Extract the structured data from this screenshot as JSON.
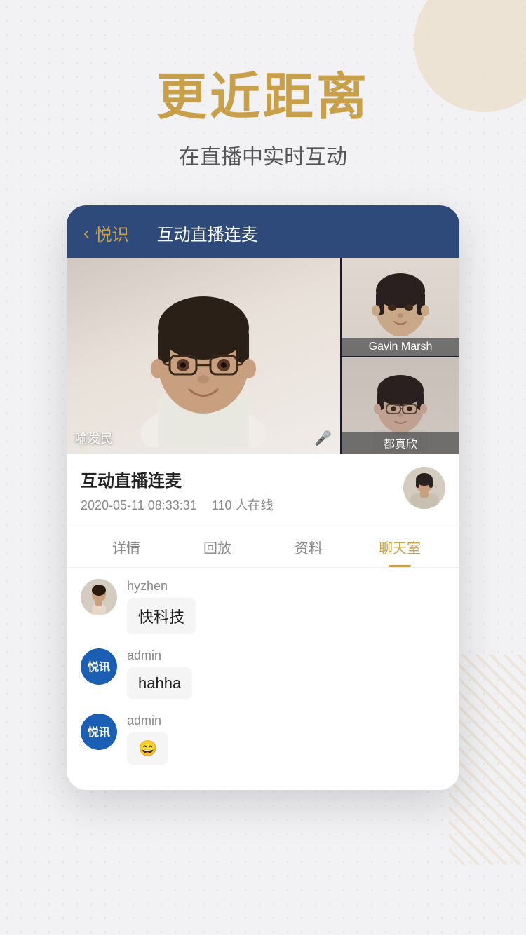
{
  "page": {
    "background_color": "#f2f2f5",
    "main_title": "更近距离",
    "sub_title": "在直播中实时互动"
  },
  "app": {
    "header": {
      "back_label": "悦识",
      "title": "互动直播连麦"
    },
    "video": {
      "main_person_name": "喻发民",
      "side_persons": [
        {
          "name": "Gavin Marsh"
        },
        {
          "name": "都真欣"
        }
      ]
    },
    "session": {
      "name": "互动直播连麦",
      "date": "2020-05-11 08:33:31",
      "viewers": "110 人在线"
    },
    "tabs": [
      {
        "label": "详情",
        "active": false
      },
      {
        "label": "回放",
        "active": false
      },
      {
        "label": "资料",
        "active": false
      },
      {
        "label": "聊天室",
        "active": true
      }
    ],
    "chat": {
      "messages": [
        {
          "username": "hyzhen",
          "avatar_type": "photo",
          "bubble_text": "快科技"
        },
        {
          "username": "admin",
          "avatar_type": "logo",
          "bubble_text": "hahha"
        },
        {
          "username": "admin",
          "avatar_type": "logo",
          "bubble_text": "😄"
        }
      ]
    }
  },
  "icons": {
    "back_chevron": "‹",
    "microphone": "🎤",
    "logo_text": "悦讯"
  }
}
